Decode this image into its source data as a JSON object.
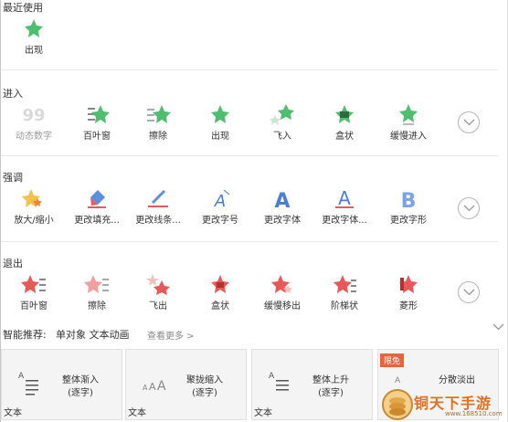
{
  "sections": {
    "recent": {
      "title": "最近使用",
      "items": [
        {
          "label": "出现",
          "icon": "star-appear-icon"
        }
      ]
    },
    "enter": {
      "title": "进入",
      "items": [
        {
          "label": "动态数字",
          "icon": "dynamic-number-icon"
        },
        {
          "label": "百叶窗",
          "icon": "star-blinds-icon"
        },
        {
          "label": "擦除",
          "icon": "star-wipe-icon"
        },
        {
          "label": "出现",
          "icon": "star-appear-icon"
        },
        {
          "label": "飞入",
          "icon": "star-fly-in-icon"
        },
        {
          "label": "盒状",
          "icon": "star-box-icon"
        },
        {
          "label": "缓慢进入",
          "icon": "star-slow-enter-icon"
        }
      ]
    },
    "emphasis": {
      "title": "强调",
      "items": [
        {
          "label": "放大/缩小",
          "icon": "star-grow-shrink-icon"
        },
        {
          "label": "更改填充...",
          "icon": "fill-bucket-icon"
        },
        {
          "label": "更改线条...",
          "icon": "line-pen-icon"
        },
        {
          "label": "更改字号",
          "icon": "font-size-icon"
        },
        {
          "label": "更改字体",
          "icon": "font-letter-a-icon"
        },
        {
          "label": "更改字体...",
          "icon": "font-color-a-icon"
        },
        {
          "label": "更改字形",
          "icon": "font-style-b-icon"
        }
      ]
    },
    "exit": {
      "title": "退出",
      "items": [
        {
          "label": "百叶窗",
          "icon": "red-star-blinds-icon"
        },
        {
          "label": "擦除",
          "icon": "red-star-wipe-icon"
        },
        {
          "label": "飞出",
          "icon": "red-star-fly-out-icon"
        },
        {
          "label": "盒状",
          "icon": "red-star-box-icon"
        },
        {
          "label": "缓慢移出",
          "icon": "red-star-slow-exit-icon"
        },
        {
          "label": "阶梯状",
          "icon": "red-star-stairs-icon"
        },
        {
          "label": "菱形",
          "icon": "red-star-diamond-icon"
        }
      ]
    }
  },
  "recommend": {
    "title": "智能推荐:",
    "tags": "单对象 文本动画",
    "more": "查看更多 >",
    "cards": [
      {
        "title": "整体渐入",
        "sub": "(逐字)",
        "caption": "文本"
      },
      {
        "title": "聚拢缩入",
        "sub": "(逐字)",
        "caption": "文本"
      },
      {
        "title": "整体上升",
        "sub": "(逐字)",
        "caption": "文本"
      },
      {
        "title": "分散淡出",
        "sub": "",
        "caption": "",
        "badge": "限免"
      }
    ]
  },
  "watermark": {
    "text": "铜天下手游",
    "url": "www.168510.com"
  },
  "colors": {
    "green_star": "#4fbf6f",
    "red_star": "#e85a5a",
    "blue_letter": "#4a7fd4",
    "orange_badge": "#e8643c",
    "divider": "#e8e8e8"
  }
}
